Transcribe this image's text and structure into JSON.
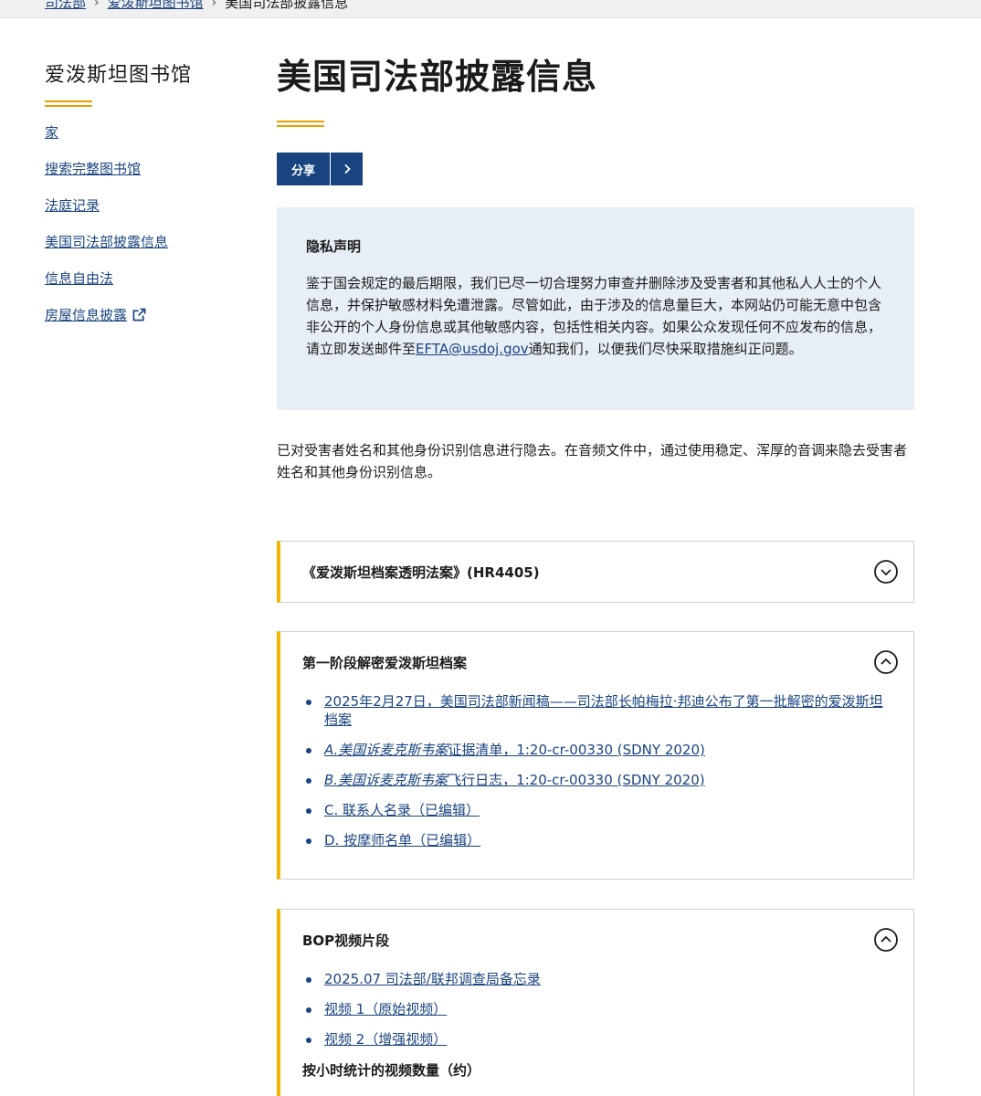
{
  "breadcrumb": {
    "items": [
      "司法部",
      "爱泼斯坦图书馆"
    ],
    "current": "美国司法部披露信息"
  },
  "sidebar": {
    "title": "爱泼斯坦图书馆",
    "links": [
      "家",
      "搜索完整图书馆",
      "法庭记录",
      "美国司法部披露信息",
      "信息自由法",
      "房屋信息披露"
    ]
  },
  "main": {
    "title": "美国司法部披露信息",
    "share_label": "分享",
    "privacy": {
      "title": "隐私声明",
      "text_before": "鉴于国会规定的最后期限，我们已尽一切合理努力审查并删除涉及受害者和其他私人人士的个人信息，并保护敏感材料免遭泄露。尽管如此，由于涉及的信息量巨大，本网站仍可能无意中包含非公开的个人身份信息或其他敏感内容，包括性相关内容。如果公众发现任何不应发布的信息，请立即发送邮件至",
      "email": "EFTA@usdoj.gov",
      "text_after": "通知我们，以便我们尽快采取措施纠正问题。"
    },
    "redact_note": "已对受害者姓名和其他身份识别信息进行隐去。在音频文件中，通过使用稳定、浑厚的音调来隐去受害者姓名和其他身份识别信息。",
    "accordions": [
      {
        "title": "《爱泼斯坦档案透明法案》(HR4405)",
        "expanded": false
      },
      {
        "title": "第一阶段解密爱泼斯坦档案",
        "expanded": true,
        "items": [
          {
            "text": "2025年2月27日，美国司法部新闻稿——司法部长帕梅拉·邦迪公布了第一批解密的爱泼斯坦档案"
          },
          {
            "italic": "A.美国诉麦克斯韦案",
            "text": "证据清单，1:20-cr-00330 (SDNY 2020)"
          },
          {
            "italic": "B.美国诉麦克斯韦案",
            "text": "飞行日志，1:20-cr-00330 (SDNY 2020)"
          },
          {
            "text": "C. 联系人名录（已编辑）"
          },
          {
            "text": "D. 按摩师名单（已编辑）"
          }
        ]
      },
      {
        "title": "BOP视频片段",
        "expanded": true,
        "items": [
          {
            "text": "2025.07 司法部/联邦调查局备忘录"
          },
          {
            "text": "视频 1（原始视频）"
          },
          {
            "text": "视频 2（增强视频）"
          }
        ],
        "subheading": "按小时统计的视频数量（约）"
      }
    ]
  },
  "colors": {
    "link": "#1a4480",
    "accent_gold": "#e5a000",
    "accordion_border": "#f5b700",
    "privacy_bg": "#e7eef6"
  },
  "icons": [
    "chevron-right-icon",
    "external-link-icon",
    "chevron-down-circle-icon",
    "chevron-up-circle-icon"
  ]
}
